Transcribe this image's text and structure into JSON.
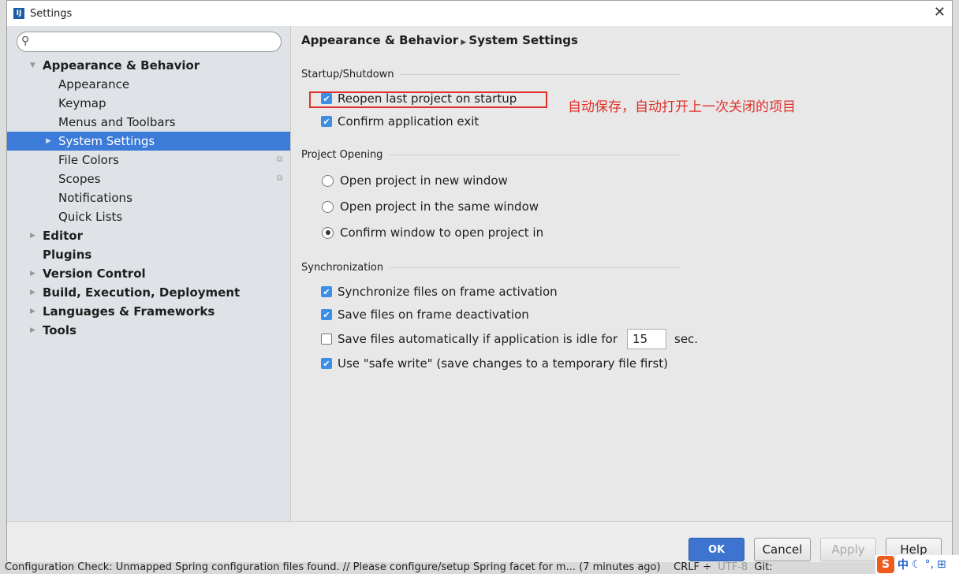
{
  "window": {
    "title": "Settings",
    "logo": "IJ",
    "close_icon": "close-icon"
  },
  "search": {
    "placeholder": "",
    "value": ""
  },
  "sidebar": {
    "items": [
      {
        "label": "Appearance & Behavior",
        "bold": true,
        "expanded": true
      },
      {
        "label": "Appearance"
      },
      {
        "label": "Keymap"
      },
      {
        "label": "Menus and Toolbars"
      },
      {
        "label": "System Settings",
        "selected": true
      },
      {
        "label": "File Colors",
        "copy_icon": true
      },
      {
        "label": "Scopes",
        "copy_icon": true
      },
      {
        "label": "Notifications"
      },
      {
        "label": "Quick Lists"
      },
      {
        "label": "Editor",
        "bold": true
      },
      {
        "label": "Plugins",
        "bold": true
      },
      {
        "label": "Version Control",
        "bold": true
      },
      {
        "label": "Build, Execution, Deployment",
        "bold": true
      },
      {
        "label": "Languages & Frameworks",
        "bold": true
      },
      {
        "label": "Tools",
        "bold": true
      }
    ]
  },
  "breadcrumb": {
    "parent": "Appearance & Behavior",
    "current": "System Settings"
  },
  "startup": {
    "title": "Startup/Shutdown",
    "reopen": "Reopen last project on startup",
    "reopen_checked": true,
    "confirm_exit": "Confirm application exit",
    "confirm_exit_checked": true
  },
  "annotation": "自动保存，自动打开上一次关闭的项目",
  "project_opening": {
    "title": "Project Opening",
    "options": [
      "Open project in new window",
      "Open project in the same window",
      "Confirm window to open project in"
    ],
    "selected": 2
  },
  "sync": {
    "title": "Synchronization",
    "sync_frame": "Synchronize files on frame activation",
    "sync_frame_checked": true,
    "save_deactivation": "Save files on frame deactivation",
    "save_deactivation_checked": true,
    "save_idle": "Save files automatically if application is idle for",
    "save_idle_checked": false,
    "idle_value": "15",
    "idle_unit": "sec.",
    "safe_write": "Use \"safe write\" (save changes to a temporary file first)",
    "safe_write_checked": true
  },
  "buttons": {
    "ok": "OK",
    "cancel": "Cancel",
    "apply": "Apply",
    "help": "Help"
  },
  "statusbar": {
    "message": "Configuration Check: Unmapped Spring configuration files found. // Please configure/setup Spring facet for m... (7 minutes ago)",
    "line_sep": "CRLF ÷",
    "encoding": "UTF-8",
    "git": "Git:"
  },
  "tray": {
    "ime": "S",
    "lang": "中"
  }
}
